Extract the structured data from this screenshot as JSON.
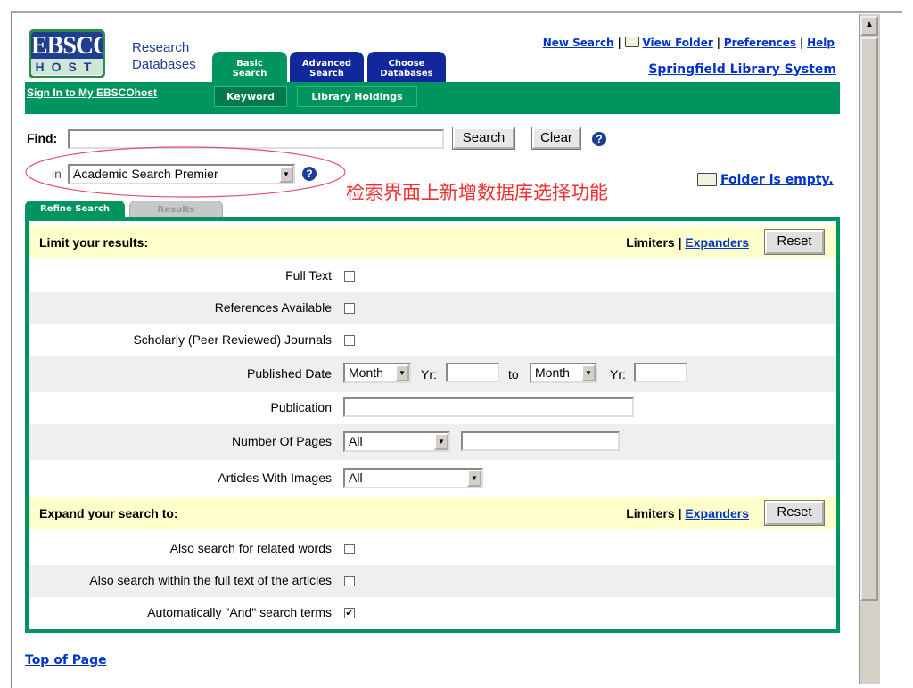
{
  "logo": {
    "line1": "EBSCO",
    "line2": "HOST",
    "tagline1": "Research",
    "tagline2": "Databases"
  },
  "tabs": [
    {
      "label1": "Basic",
      "label2": "Search"
    },
    {
      "label1": "Advanced",
      "label2": "Search"
    },
    {
      "label1": "Choose",
      "label2": "Databases"
    }
  ],
  "subtabs": [
    "Keyword",
    "Library Holdings"
  ],
  "sign_in": "Sign In to My EBSCOhost",
  "top_links": {
    "new_search": "New Search",
    "sep": "|",
    "view_folder": "View Folder",
    "preferences": "Preferences",
    "help": "Help"
  },
  "library": "Springfield Library System",
  "find": {
    "label": "Find:",
    "value": "",
    "search": "Search",
    "clear": "Clear",
    "help": "?"
  },
  "db": {
    "label": "in",
    "value": "Academic Search Premier",
    "help": "?"
  },
  "annotation": "检索界面上新增数据库选择功能",
  "folder_status": "Folder is empty.",
  "result_tabs": [
    "Refine Search",
    "Results"
  ],
  "limit": {
    "header": "Limit your results:",
    "limiters": "Limiters",
    "sep": "|",
    "expanders": "Expanders",
    "reset": "Reset",
    "full_text": "Full Text",
    "references": "References Available",
    "scholarly": "Scholarly (Peer Reviewed) Journals",
    "published": "Published Date",
    "month1": "Month",
    "yr": "Yr:",
    "to": "to",
    "month2": "Month",
    "publication": "Publication",
    "pages": "Number Of Pages",
    "pages_value": "All",
    "images": "Articles With Images",
    "images_value": "All"
  },
  "expand": {
    "header": "Expand your search to:",
    "limiters": "Limiters",
    "sep": "|",
    "expanders": "Expanders",
    "reset": "Reset",
    "related": "Also search for related words",
    "fulltext": "Also search within the full text of the articles",
    "and": "Automatically \"And\" search terms",
    "and_checked": "✔"
  },
  "top_of_page": "Top of Page"
}
